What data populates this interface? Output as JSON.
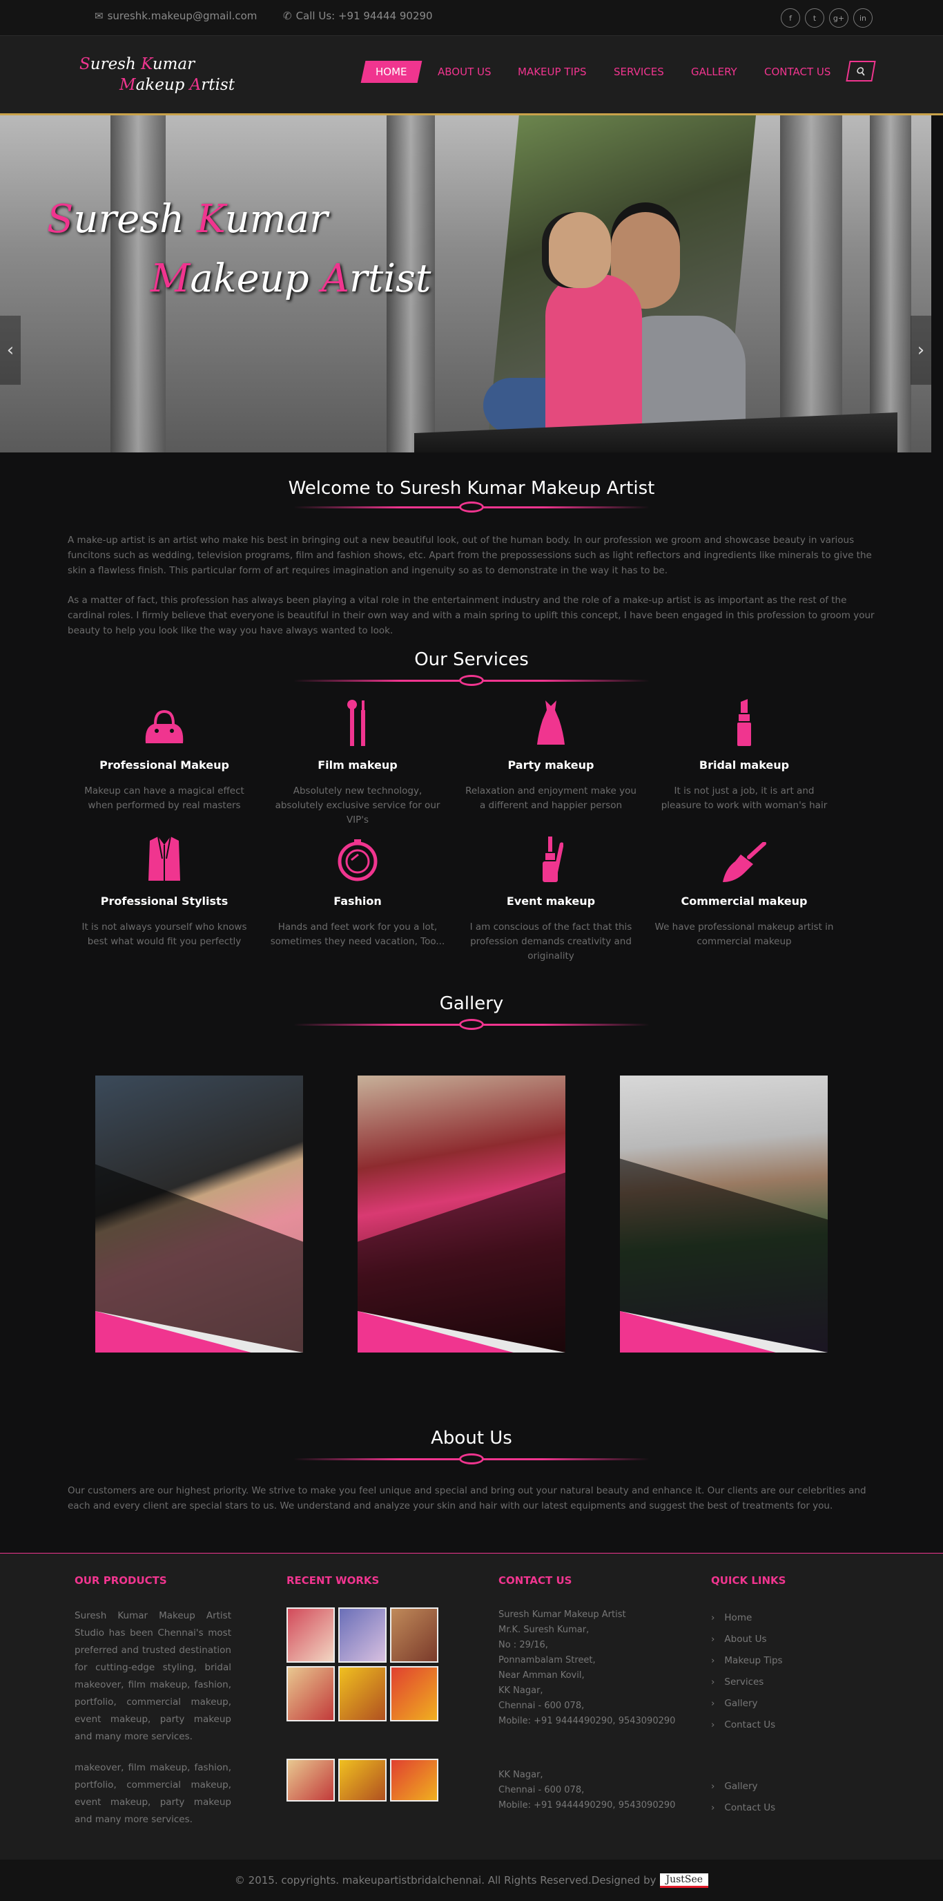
{
  "topbar": {
    "email": "sureshk.makeup@gmail.com",
    "phone": "Call Us: +91 94444 90290",
    "social": [
      "f",
      "t",
      "g+",
      "in"
    ]
  },
  "logo": {
    "line1": "Suresh Kumar",
    "line2": "Makeup Artist"
  },
  "nav": {
    "items": [
      "HOME",
      "ABOUT US",
      "MAKEUP TIPS",
      "SERVICES",
      "GALLERY",
      "CONTACT US"
    ]
  },
  "hero": {
    "line1": "Suresh Kumar",
    "line2": "Makeup Artist",
    "prev": "‹",
    "next": "›"
  },
  "welcome": {
    "title": "Welcome to Suresh Kumar Makeup Artist",
    "p1": "A make-up artist is an artist who make his best in bringing out a new beautiful look, out of the human body. In our profession we groom and showcase beauty in various funcitons such as wedding, television programs, film and fashion shows, etc. Apart from the prepossessions such as light reflectors and ingredients like minerals to give the skin a flawless finish. This particular form of art requires imagination and ingenuity so as to demonstrate in the way it has to be.",
    "p2": "As a matter of fact, this profession has always been playing a vital role in the entertainment industry and the role of a make-up artist is as important as the rest of the cardinal roles. I firmly believe that everyone is beautiful in their own way and with a main spring to uplift this concept, I have been engaged in this profession to groom your beauty to help you look like the way you have always wanted to look."
  },
  "services": {
    "title": "Our Services",
    "items": [
      {
        "icon": "handbag-icon",
        "name": "Professional Makeup",
        "desc": "Makeup can have a magical effect when performed by real masters"
      },
      {
        "icon": "brushes-icon",
        "name": "Film makeup",
        "desc": "Absolutely new technology, absolutely exclusive service for our VIP's"
      },
      {
        "icon": "dress-icon",
        "name": "Party makeup",
        "desc": "Relaxation and enjoyment make you a different and happier person"
      },
      {
        "icon": "lipstick-icon",
        "name": "Bridal makeup",
        "desc": "It is not just a job, it is art and pleasure to work with woman's hair"
      },
      {
        "icon": "jacket-icon",
        "name": "Professional Stylists",
        "desc": "It is not always yourself who knows best what would fit you perfectly"
      },
      {
        "icon": "compact-mirror-icon",
        "name": "Fashion",
        "desc": "Hands and feet work for you a lot, sometimes they need vacation, Too..."
      },
      {
        "icon": "nail-polish-icon",
        "name": "Event makeup",
        "desc": "I am conscious of the fact that this profession demands creativity and originality"
      },
      {
        "icon": "makeup-brush-icon",
        "name": "Commercial makeup",
        "desc": "We have professional makeup artist in commercial makeup"
      }
    ]
  },
  "gallery": {
    "title": "Gallery"
  },
  "about": {
    "title": "About Us",
    "text": "Our customers are our highest priority. We strive to make you feel unique and special and bring out your natural beauty and enhance it. Our clients are our celebrities and each and every client are special stars to us. We understand and analyze your skin and hair with our latest equipments and suggest the best of treatments for you."
  },
  "footer": {
    "products": {
      "title": "OUR PRODUCTS",
      "p1": "Suresh Kumar Makeup Artist Studio has been Chennai's most preferred and trusted destination for cutting-edge styling, bridal makeover, film makeup, fashion, portfolio, commercial makeup, event makeup, party makeup and many more services.",
      "p2": "makeover, film makeup, fashion, portfolio, commercial makeup, event makeup, party makeup and many more services."
    },
    "recent": {
      "title": "RECENT WORKS"
    },
    "contact": {
      "title": "CONTACT US",
      "lines": [
        "Suresh Kumar Makeup Artist",
        "Mr.K. Suresh Kumar,",
        "No : 29/16,",
        "Ponnambalam Street,",
        "Near Amman Kovil,",
        "KK Nagar,",
        "Chennai - 600 078,",
        "Mobile: +91 9444490290, 9543090290"
      ],
      "lines2": [
        "KK Nagar,",
        "Chennai - 600 078,",
        "Mobile: +91 9444490290, 9543090290"
      ]
    },
    "quick": {
      "title": "QUICK LINKS",
      "items": [
        "Home",
        "About Us",
        "Makeup Tips",
        "Services",
        "Gallery",
        "Contact Us"
      ],
      "items2": [
        "Gallery",
        "Contact Us"
      ]
    }
  },
  "copyright": {
    "text": "© 2015. copyrights. makeupartistbridalchennai. All Rights Reserved.Designed by",
    "designer": "JustSee"
  },
  "colors": {
    "accent": "#f0358f",
    "background": "#101011",
    "footer": "#1d1d1d"
  }
}
